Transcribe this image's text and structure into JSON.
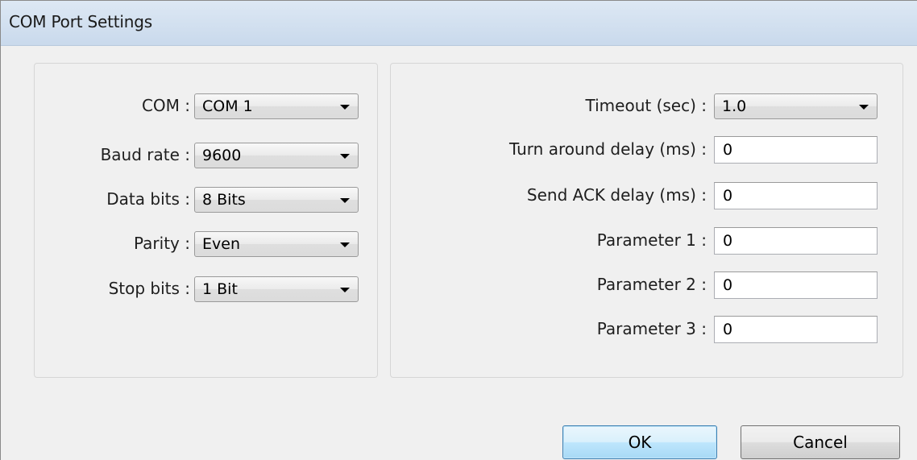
{
  "window": {
    "title": "COM Port Settings"
  },
  "left_panel": {
    "fields": [
      {
        "label": "COM :",
        "value": "COM 1"
      },
      {
        "label": "Baud rate :",
        "value": "9600"
      },
      {
        "label": "Data bits :",
        "value": "8 Bits"
      },
      {
        "label": "Parity :",
        "value": "Even"
      },
      {
        "label": "Stop bits :",
        "value": "1 Bit"
      }
    ]
  },
  "right_panel": {
    "timeout": {
      "label": "Timeout (sec) :",
      "value": "1.0"
    },
    "fields": [
      {
        "label": "Turn around delay (ms) :",
        "value": "0"
      },
      {
        "label": "Send ACK delay (ms) :",
        "value": "0"
      },
      {
        "label": "Parameter 1 :",
        "value": "0"
      },
      {
        "label": "Parameter 2 :",
        "value": "0"
      },
      {
        "label": "Parameter 3 :",
        "value": "0"
      }
    ]
  },
  "buttons": {
    "ok": "OK",
    "cancel": "Cancel"
  },
  "icons": {
    "dropdown": "chevron-down-icon"
  }
}
